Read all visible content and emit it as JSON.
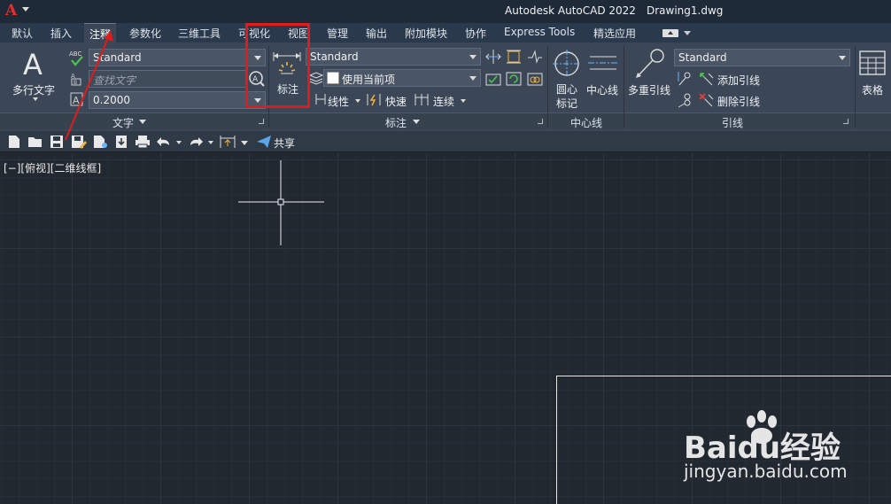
{
  "titlebar": {
    "logo": "A",
    "app": "Autodesk AutoCAD 2022",
    "file": "Drawing1.dwg"
  },
  "tabs": [
    {
      "label": "默认"
    },
    {
      "label": "插入"
    },
    {
      "label": "注释",
      "active": true
    },
    {
      "label": "参数化"
    },
    {
      "label": "三维工具"
    },
    {
      "label": "可视化"
    },
    {
      "label": "视图"
    },
    {
      "label": "管理"
    },
    {
      "label": "输出"
    },
    {
      "label": "附加模块"
    },
    {
      "label": "协作"
    },
    {
      "label": "Express Tools"
    },
    {
      "label": "精选应用"
    }
  ],
  "text_panel": {
    "mtext_label": "多行文字",
    "style_value": "Standard",
    "find_placeholder": "查找文字",
    "height_value": "0.2000",
    "title": "文字"
  },
  "dim_panel": {
    "dimension_label": "标注",
    "style_value": "Standard",
    "layer_value": "使用当前项",
    "linear_label": "线性",
    "quick_label": "快速",
    "continue_label": "连续",
    "title": "标注"
  },
  "centerline_panel": {
    "center_mark_label": "圆心\n标记",
    "centerline_label": "中心线",
    "title": "中心线"
  },
  "leader_panel": {
    "mleader_label": "多重引线",
    "style_value": "Standard",
    "add_label": "添加引线",
    "remove_label": "删除引线",
    "title": "引线"
  },
  "table_panel": {
    "table_label": "表格"
  },
  "qat": {
    "share_label": "共享"
  },
  "viewport": {
    "label": "[−][俯视][二维线框]"
  },
  "watermark": {
    "brand": "Baidu经验",
    "url": "jingyan.baidu.com"
  },
  "colors": {
    "highlight": "#e11b1b",
    "canvas": "#212830",
    "ribbon": "#3b4756",
    "logo": "#e03030"
  }
}
